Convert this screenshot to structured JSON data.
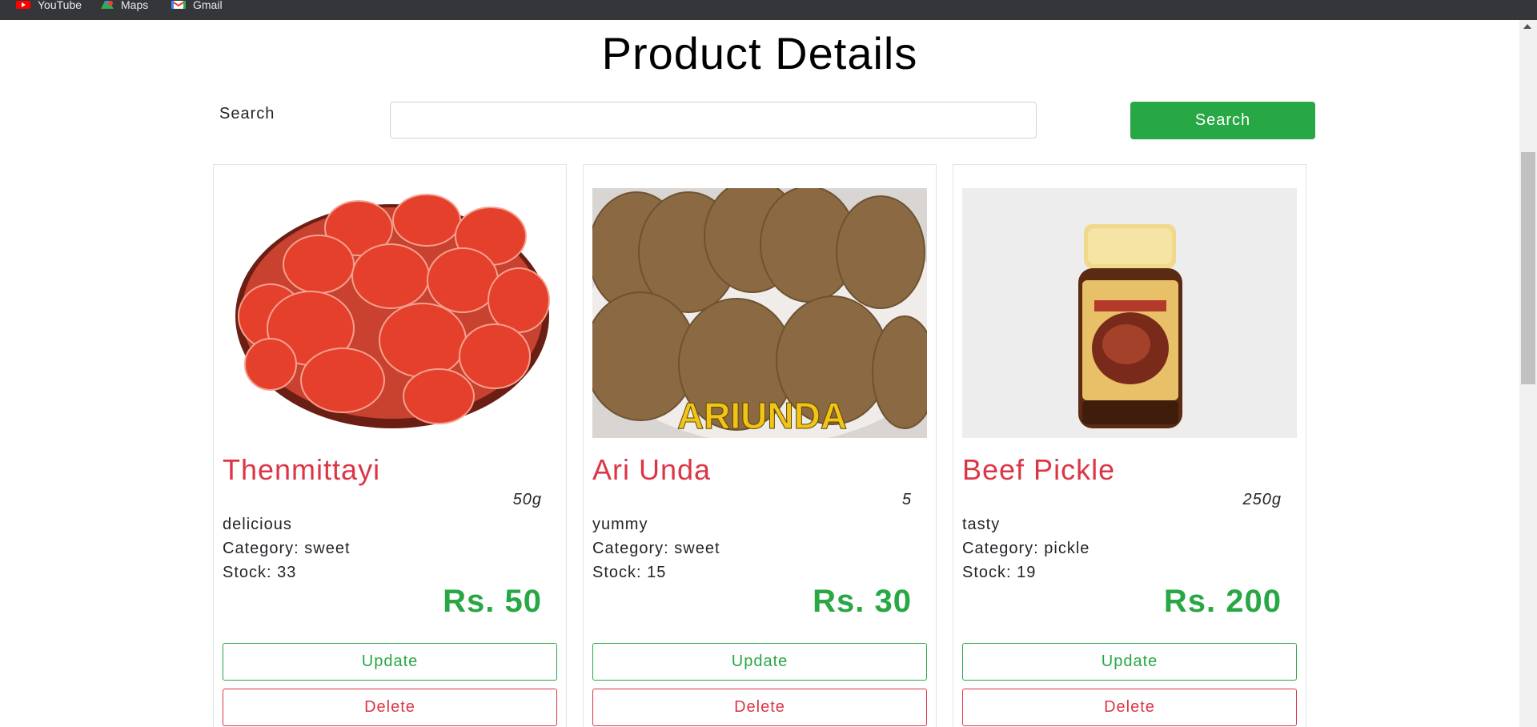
{
  "bookmarks": [
    {
      "label": "YouTube",
      "icon": "youtube-icon"
    },
    {
      "label": "Maps",
      "icon": "maps-icon"
    },
    {
      "label": "Gmail",
      "icon": "gmail-icon"
    }
  ],
  "page": {
    "title": "Product Details"
  },
  "search": {
    "label": "Search",
    "value": "",
    "placeholder": "",
    "button": "Search"
  },
  "colors": {
    "accent": "#28a745",
    "danger": "#dc3545"
  },
  "products": [
    {
      "name": "Thenmittayi",
      "quantity": "50g",
      "description": "delicious",
      "category": "Category: sweet",
      "stock": "Stock: 33",
      "price": "Rs. 50",
      "update": "Update",
      "delete": "Delete",
      "image": "sweet-balls-image"
    },
    {
      "name": "Ari Unda",
      "quantity": "5",
      "description": "yummy",
      "category": "Category: sweet",
      "stock": "Stock: 15",
      "price": "Rs. 30",
      "update": "Update",
      "delete": "Delete",
      "image": "rice-balls-image",
      "image_caption": "ARIUNDA"
    },
    {
      "name": "Beef Pickle",
      "quantity": "250g",
      "description": "tasty",
      "category": "Category: pickle",
      "stock": "Stock: 19",
      "price": "Rs. 200",
      "update": "Update",
      "delete": "Delete",
      "image": "pickle-jar-image"
    }
  ]
}
